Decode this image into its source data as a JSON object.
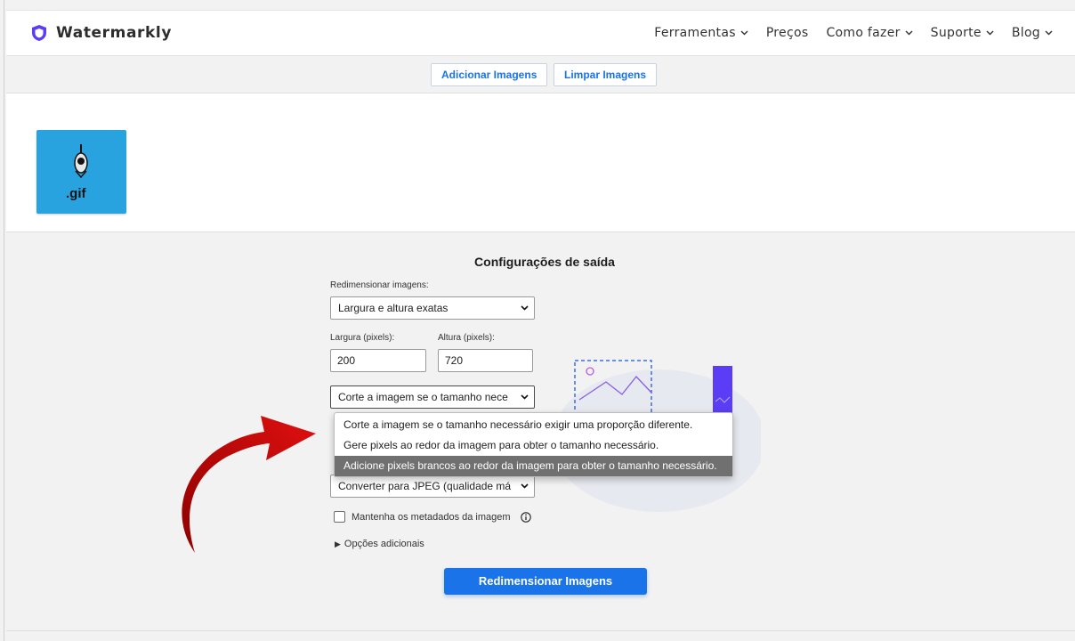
{
  "brand": {
    "name": "Watermarkly",
    "color": "#5b3df5"
  },
  "nav": {
    "items": [
      {
        "label": "Ferramentas",
        "has_menu": true
      },
      {
        "label": "Preços",
        "has_menu": false
      },
      {
        "label": "Como fazer",
        "has_menu": true
      },
      {
        "label": "Suporte",
        "has_menu": true
      },
      {
        "label": "Blog",
        "has_menu": true
      }
    ]
  },
  "toolbar": {
    "add_images": "Adicionar Imagens",
    "clear_images": "Limpar Imagens"
  },
  "images": [
    {
      "label": ".gif",
      "icon": "mouse-gif-thumbnail",
      "bg": "#29a3e0"
    }
  ],
  "settings": {
    "title": "Configurações de saída",
    "resize_label": "Redimensionar imagens:",
    "resize_value": "Largura e altura exatas",
    "width_label": "Largura (pixels):",
    "width_value": "200",
    "height_label": "Altura (pixels):",
    "height_value": "720",
    "fit_value": "Corte a imagem se o tamanho nece",
    "fit_options": [
      "Corte a imagem se o tamanho necessário exigir uma proporção diferente.",
      "Gere pixels ao redor da imagem para obter o tamanho necessário.",
      "Adicione pixels brancos ao redor da imagem para obter o tamanho necessário."
    ],
    "fit_highlighted_index": 2,
    "format_value": "Converter para JPEG (qualidade má",
    "metadata_label": "Mantenha os metadados da imagem",
    "metadata_checked": false,
    "more_options": "Opções adicionais",
    "submit": "Redimensionar Imagens"
  },
  "annotation": {
    "type": "red-curved-arrow",
    "color": "#b00000"
  },
  "accent": "#1a73e8"
}
